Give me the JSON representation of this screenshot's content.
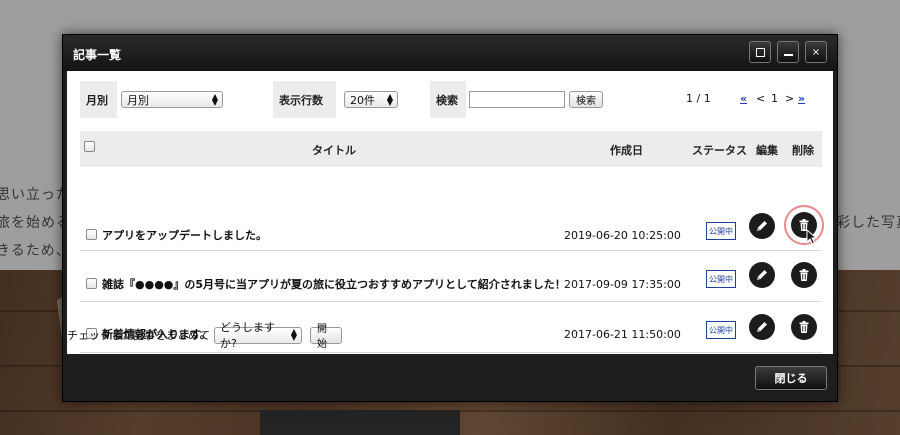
{
  "background": {
    "lines": [
      "思い立った",
      "旅を始める",
      "きるため、"
    ],
    "right_line": "彩した写真"
  },
  "window": {
    "title": "記事一覧",
    "maximize_icon": "maximize-icon",
    "minimize_icon": "minimize-icon",
    "close_glyph": "×"
  },
  "filters": {
    "month_label": "月別",
    "month_value": "月別",
    "rows_label": "表示行数",
    "rows_value": "20件",
    "search_label": "検索",
    "search_value": "",
    "search_button": "検索"
  },
  "pager": {
    "page_info": "1 / 1",
    "first": "«",
    "prev": "<",
    "current": "1",
    "next": ">",
    "last": "»"
  },
  "table": {
    "headers": {
      "title": "タイトル",
      "created": "作成日",
      "status": "ステータス",
      "edit": "編集",
      "delete": "削除"
    },
    "rows": [
      {
        "title": "アプリをアップデートしました。",
        "created": "2019-06-20 10:25:00",
        "status": "公開中"
      },
      {
        "title": "雑誌『●●●●』の5月号に当アプリが夏の旅に役立つおすすめアプリとして紹介されました！",
        "created": "2017-09-09 17:35:00",
        "status": "公開中"
      },
      {
        "title": "新着情報が入ります。",
        "created": "2017-06-21 11:50:00",
        "status": "公開中"
      }
    ]
  },
  "bulk": {
    "label": "チェックした記事をまとめて",
    "select_value": "どうしますか?",
    "start_button": "開始"
  },
  "footer": {
    "close_button": "閉じる"
  },
  "colors": {
    "status_border": "#1f3f9f",
    "pager_link": "#1a3fc2",
    "highlight_ring": "#e98a8a"
  }
}
